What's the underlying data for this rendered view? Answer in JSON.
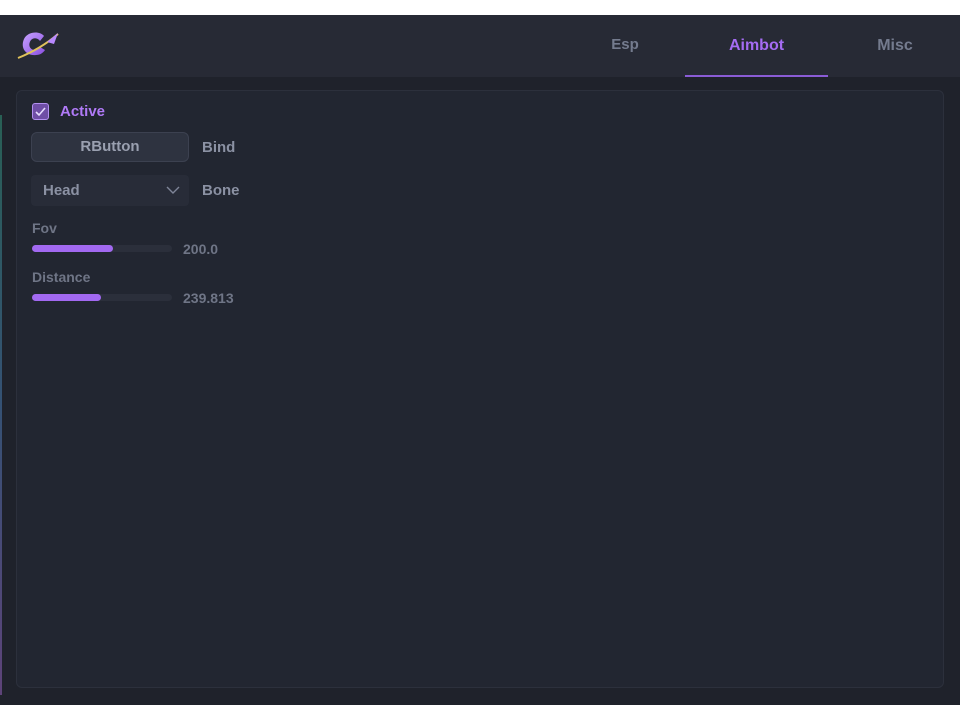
{
  "colors": {
    "accent": "#a56cf3",
    "background": "#1f222b",
    "header": "#272a35",
    "panel": "#222631",
    "muted_text": "#747b8e"
  },
  "header": {
    "logo_icon": "planet-c-logo-icon",
    "tabs": [
      {
        "label": "Esp",
        "selected": false
      },
      {
        "label": "Aimbot",
        "selected": true
      },
      {
        "label": "Misc",
        "selected": false
      }
    ]
  },
  "aimbot": {
    "active": {
      "label": "Active",
      "checked": true,
      "icon": "checkmark-icon"
    },
    "bind": {
      "button_label": "RButton",
      "label": "Bind"
    },
    "bone": {
      "selected": "Head",
      "label": "Bone",
      "icon": "chevron-down-icon"
    },
    "fov": {
      "label": "Fov",
      "value_text": "200.0",
      "fill_fraction": 0.58
    },
    "distance": {
      "label": "Distance",
      "value_text": "239.813",
      "fill_fraction": 0.49
    }
  }
}
